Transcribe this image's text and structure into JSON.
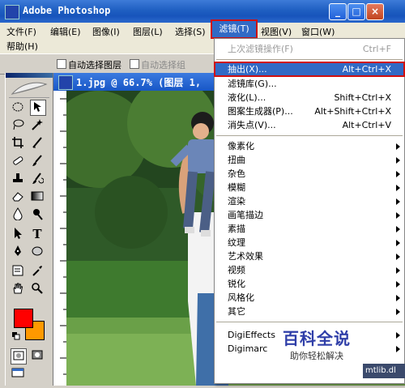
{
  "window": {
    "title": "Adobe Photoshop",
    "min_label": "_",
    "max_label": "□",
    "close_label": "×"
  },
  "menubar": {
    "items": [
      "文件(F)",
      "编辑(E)",
      "图像(I)",
      "图层(L)",
      "选择(S)",
      "滤镜(T)",
      "视图(V)",
      "窗口(W)"
    ],
    "row2": [
      "帮助(H)"
    ],
    "active": "滤镜(T)"
  },
  "options": {
    "auto_select_layer": "自动选择图层",
    "show_bounds": "自动选择组"
  },
  "document": {
    "title": "1.jpg @ 66.7% (图层 1,",
    "zoom_percent": 66.7
  },
  "filter_menu": {
    "last_filter": {
      "label": "上次滤镜操作(F)",
      "shortcut": "Ctrl+F"
    },
    "group1": [
      {
        "label": "抽出(X)...",
        "shortcut": "Alt+Ctrl+X"
      },
      {
        "label": "滤镜库(G)...",
        "shortcut": ""
      },
      {
        "label": "液化(L)...",
        "shortcut": "Shift+Ctrl+X"
      },
      {
        "label": "图案生成器(P)...",
        "shortcut": "Alt+Shift+Ctrl+X"
      },
      {
        "label": "消失点(V)...",
        "shortcut": "Alt+Ctrl+V"
      }
    ],
    "group2": [
      "像素化",
      "扭曲",
      "杂色",
      "模糊",
      "渲染",
      "画笔描边",
      "素描",
      "纹理",
      "艺术效果",
      "视频",
      "锐化",
      "风格化",
      "其它"
    ],
    "group3": [
      "DigiEffects",
      "Digimarc"
    ]
  },
  "toolbox": {
    "foreground_color": "#ff0000",
    "background_color": "#ff9900",
    "tools": [
      "marquee-icon",
      "move-icon",
      "lasso-icon",
      "magic-wand-icon",
      "crop-icon",
      "slice-icon",
      "healing-icon",
      "brush-icon",
      "stamp-icon",
      "history-brush-icon",
      "eraser-icon",
      "gradient-icon",
      "blur-icon",
      "dodge-icon",
      "path-select-icon",
      "type-icon",
      "pen-icon",
      "shape-icon",
      "notes-icon",
      "eyedropper-icon",
      "hand-icon",
      "zoom-icon"
    ]
  },
  "watermark": {
    "big": "百科全说",
    "small": "助你轻松解决"
  },
  "corner_text": "mtlib.dl"
}
